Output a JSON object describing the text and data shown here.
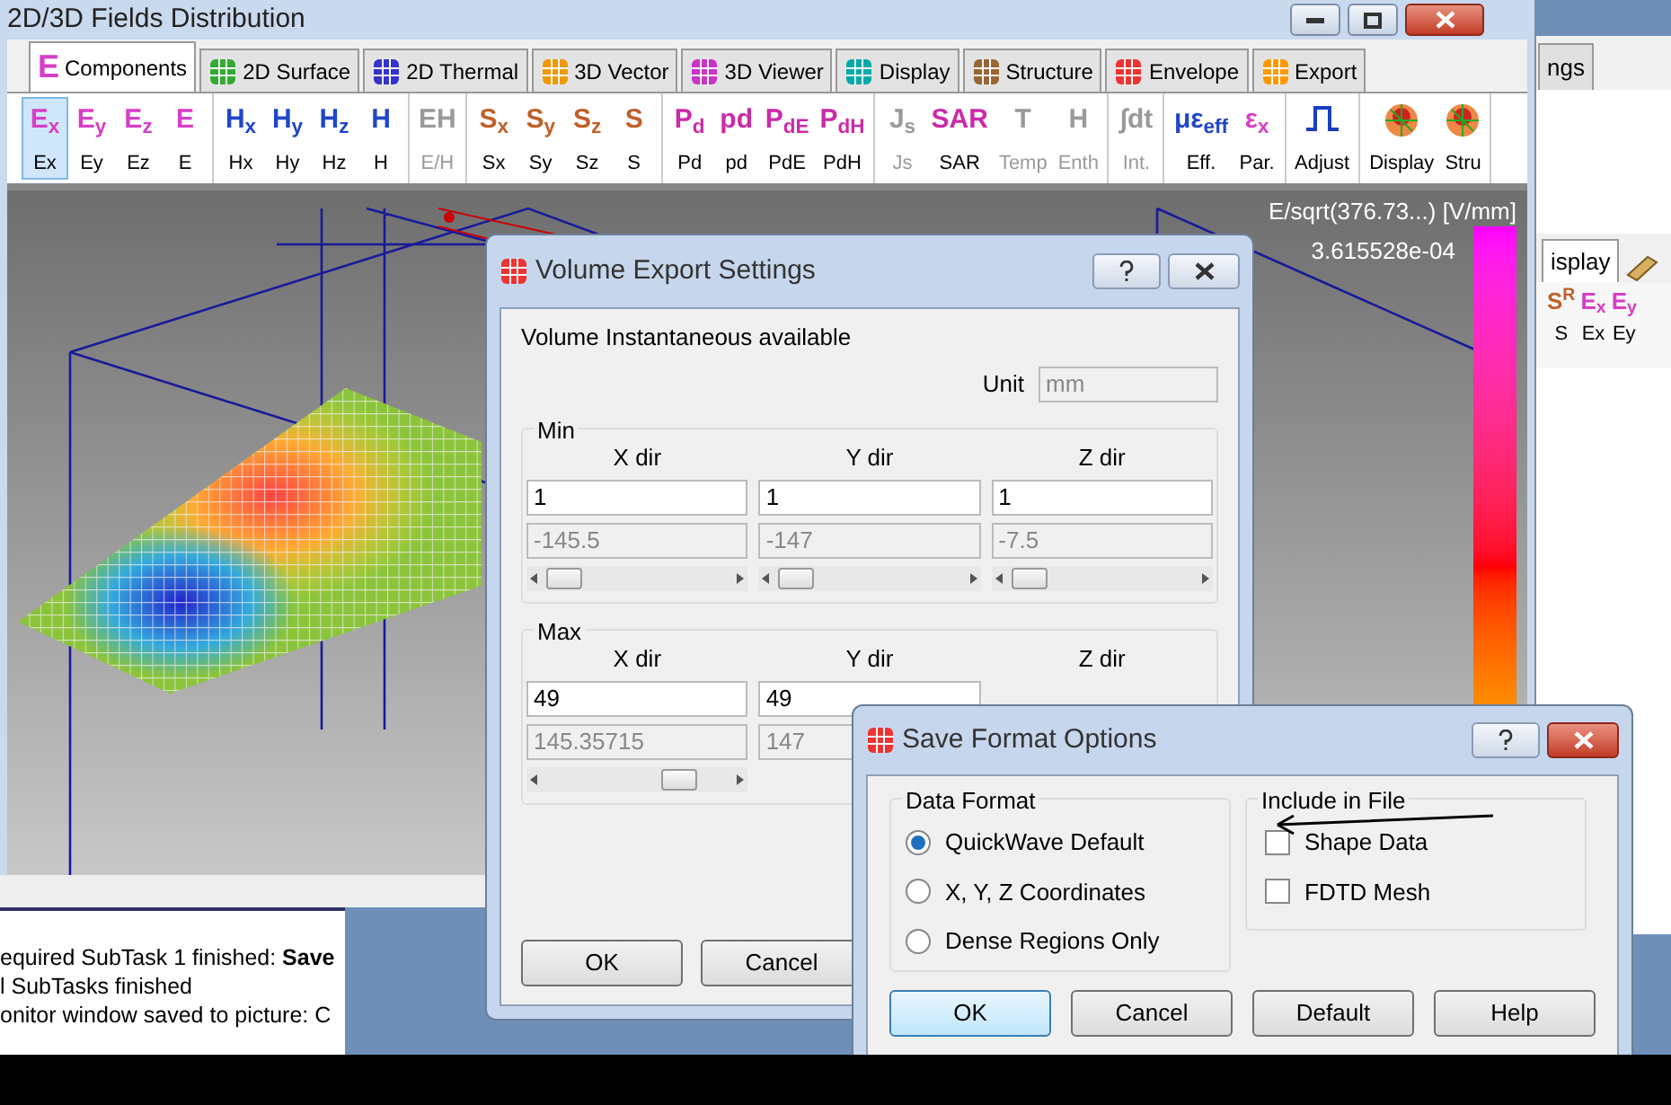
{
  "main_window": {
    "title": "2D/3D Fields Distribution",
    "tabs": [
      {
        "label": "Components",
        "glyph": "E",
        "selected": true
      },
      {
        "label": "2D Surface",
        "selected": false
      },
      {
        "label": "2D Thermal",
        "selected": false
      },
      {
        "label": "3D Vector",
        "selected": false
      },
      {
        "label": "3D Viewer",
        "selected": false
      },
      {
        "label": "Display",
        "selected": false
      },
      {
        "label": "Structure",
        "selected": false
      },
      {
        "label": "Envelope",
        "selected": false
      },
      {
        "label": "Export",
        "selected": false
      }
    ],
    "toolbar_groups": [
      [
        {
          "glyph": "E$_{x}$",
          "label": "Ex",
          "color": "#d63fc6",
          "disabled": false,
          "selected": true
        },
        {
          "glyph": "E$_{y}$",
          "label": "Ey",
          "color": "#d63fc6",
          "disabled": false,
          "selected": false
        },
        {
          "glyph": "E$_{z}$",
          "label": "Ez",
          "color": "#d63fc6",
          "disabled": false,
          "selected": false
        },
        {
          "glyph": "E",
          "label": "E",
          "color": "#d63fc6",
          "disabled": false,
          "selected": false
        }
      ],
      [
        {
          "glyph": "H$_{x}$",
          "label": "Hx",
          "color": "#2046c8",
          "disabled": false,
          "selected": false
        },
        {
          "glyph": "H$_{y}$",
          "label": "Hy",
          "color": "#2046c8",
          "disabled": false,
          "selected": false
        },
        {
          "glyph": "H$_{z}$",
          "label": "Hz",
          "color": "#2046c8",
          "disabled": false,
          "selected": false
        },
        {
          "glyph": "H",
          "label": "H",
          "color": "#2046c8",
          "disabled": false,
          "selected": false
        }
      ],
      [
        {
          "glyph": "EH",
          "label": "E/H",
          "color": "#9a9a9a",
          "disabled": true,
          "selected": false
        }
      ],
      [
        {
          "glyph": "S$_{x}$",
          "label": "Sx",
          "color": "#c0602a",
          "disabled": false,
          "selected": false
        },
        {
          "glyph": "S$_{y}$",
          "label": "Sy",
          "color": "#c0602a",
          "disabled": false,
          "selected": false
        },
        {
          "glyph": "S$_{z}$",
          "label": "Sz",
          "color": "#c0602a",
          "disabled": false,
          "selected": false
        },
        {
          "glyph": "S",
          "label": "S",
          "color": "#c0602a",
          "disabled": false,
          "selected": false
        }
      ],
      [
        {
          "glyph": "P$_{d}$",
          "label": "Pd",
          "color": "#cc2aa8",
          "disabled": false,
          "selected": false
        },
        {
          "glyph": "pd",
          "label": "pd",
          "color": "#cc2aa8",
          "disabled": false,
          "selected": false
        },
        {
          "glyph": "P$_{dE}$",
          "label": "PdE",
          "color": "#cc2aa8",
          "disabled": false,
          "selected": false
        },
        {
          "glyph": "P$_{dH}$",
          "label": "PdH",
          "color": "#cc2aa8",
          "disabled": false,
          "selected": false
        }
      ],
      [
        {
          "glyph": "J$_{s}$",
          "label": "Js",
          "color": "#9a9a9a",
          "disabled": true,
          "selected": false
        },
        {
          "glyph": "SAR",
          "label": "SAR",
          "color": "#cc2aa8",
          "disabled": false,
          "selected": false
        },
        {
          "glyph": "T",
          "label": "Temp",
          "color": "#9a9a9a",
          "disabled": true,
          "selected": false
        },
        {
          "glyph": "H",
          "label": "Enth",
          "color": "#9a9a9a",
          "disabled": true,
          "selected": false
        }
      ],
      [
        {
          "glyph": "∫dt",
          "label": "Int.",
          "color": "#9a9a9a",
          "disabled": true,
          "selected": false
        }
      ],
      [
        {
          "glyph": "με$_{eff}$",
          "label": "Eff.",
          "color": "#2046c8",
          "disabled": false,
          "selected": false
        },
        {
          "glyph": "ε$_{x}$",
          "label": "Par.",
          "color": "#d63fc6",
          "disabled": false,
          "selected": false
        }
      ],
      [
        {
          "kind": "pulse",
          "label": "Adjust",
          "disabled": false,
          "selected": false
        }
      ],
      [
        {
          "kind": "mesh",
          "label": "Display",
          "disabled": false,
          "selected": false
        },
        {
          "kind": "mesh",
          "label": "Stru",
          "disabled": false,
          "selected": false
        }
      ]
    ],
    "scale_title": "E/sqrt(376.73...) [V/mm]",
    "scale_max": "3.615528e-04"
  },
  "back_window": {
    "tab_cut": "ngs",
    "tab_label": "isplay",
    "toolbar": [
      {
        "glyph": "S$^{R}$",
        "label": "S",
        "color": "#c0602a"
      },
      {
        "glyph": "E$_{x}$",
        "label": "Ex",
        "color": "#d63fc6"
      },
      {
        "glyph": "E$_{y}$",
        "label": "Ey",
        "color": "#d63fc6"
      }
    ]
  },
  "log": [
    "equired SubTask 1 finished: **Save**",
    "l SubTasks finished",
    "onitor window saved to picture: C"
  ],
  "volume_dialog": {
    "title": "Volume Export Settings",
    "status": "Volume Instantaneous available",
    "unit_label": "Unit",
    "unit_value": "mm",
    "groups": [
      {
        "title": "Min",
        "columns": [
          {
            "header": "X dir",
            "value": "1",
            "coordinate": "-145.5",
            "level": 0.12
          },
          {
            "header": "Y dir",
            "value": "1",
            "coordinate": "-147",
            "level": 0.12
          },
          {
            "header": "Z dir",
            "value": "1",
            "coordinate": "-7.5",
            "level": 0.12
          }
        ]
      },
      {
        "title": "Max",
        "columns": [
          {
            "header": "X dir",
            "value": "49",
            "coordinate": "145.35715",
            "level": 0.72
          },
          {
            "header": "Y dir",
            "value": "49",
            "coordinate": "147"
          },
          {
            "header": "Z dir"
          }
        ]
      }
    ],
    "buttons": [
      "OK",
      "Cancel"
    ]
  },
  "save_dialog": {
    "title": "Save Format Options",
    "data_format_title": "Data Format",
    "formats": [
      {
        "label": "QuickWave Default",
        "selected": true
      },
      {
        "label": "X, Y, Z Coordinates",
        "selected": false
      },
      {
        "label": "Dense Regions Only",
        "selected": false
      }
    ],
    "include_title": "Include in File",
    "includes": [
      {
        "label": "Shape Data",
        "checked": false
      },
      {
        "label": "FDTD Mesh",
        "checked": false
      }
    ],
    "buttons": [
      {
        "label": "OK",
        "default": true
      },
      {
        "label": "Cancel",
        "default": false
      },
      {
        "label": "Default",
        "default": false
      },
      {
        "label": "Help",
        "default": false
      }
    ]
  }
}
